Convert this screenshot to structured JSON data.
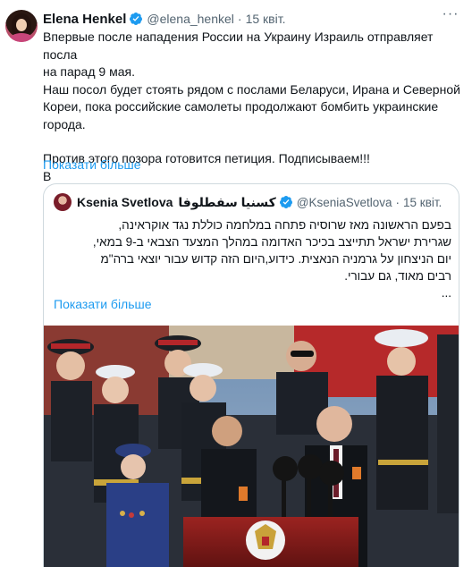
{
  "tweet": {
    "author": {
      "name": "Elena Henkel",
      "handle": "@elena_henkel",
      "time": "15 квіт."
    },
    "text_lines": [
      "Впервые после нападения России на Украину Израиль отправляет посла",
      "на парад 9 мая.",
      "Наш посол будет стоять рядом с послами Беларуси, Ирана и Северной",
      "Кореи, пока российские самолеты продолжают бомбить украинские",
      "города.",
      "",
      "Против этого позора готовится петиция. Подписываем!!!",
      "В"
    ],
    "show_more": "Показати більше",
    "more_icon": "more-horizontal-icon",
    "verified_icon": "verified-badge-icon",
    "accent_color": "#1d9bf0"
  },
  "quote": {
    "author": {
      "name": "Ksenia Svetlova",
      "name_arabic": "كسنيا سفطلوفا",
      "handle": "@KseniaSvetlova",
      "time": "15 квіт."
    },
    "text_lines": [
      "בפעם הראשונה מאז שרוסיה פתחה במלחמה כוללת נגד אוקראינה,",
      "שגרירת ישראל תתייצב בכיכר האדומה במהלך המצעד הצבאי ב-9 במאי,",
      "יום הניצחון על גרמניה הנאצית. כידוע,היום הזה קדוש עבור יוצאי ברה\"מ",
      "רבים מאוד, גם עבורי.",
      "..."
    ],
    "show_more": "Показати більше",
    "photo_description_icon": "parade-photo"
  }
}
